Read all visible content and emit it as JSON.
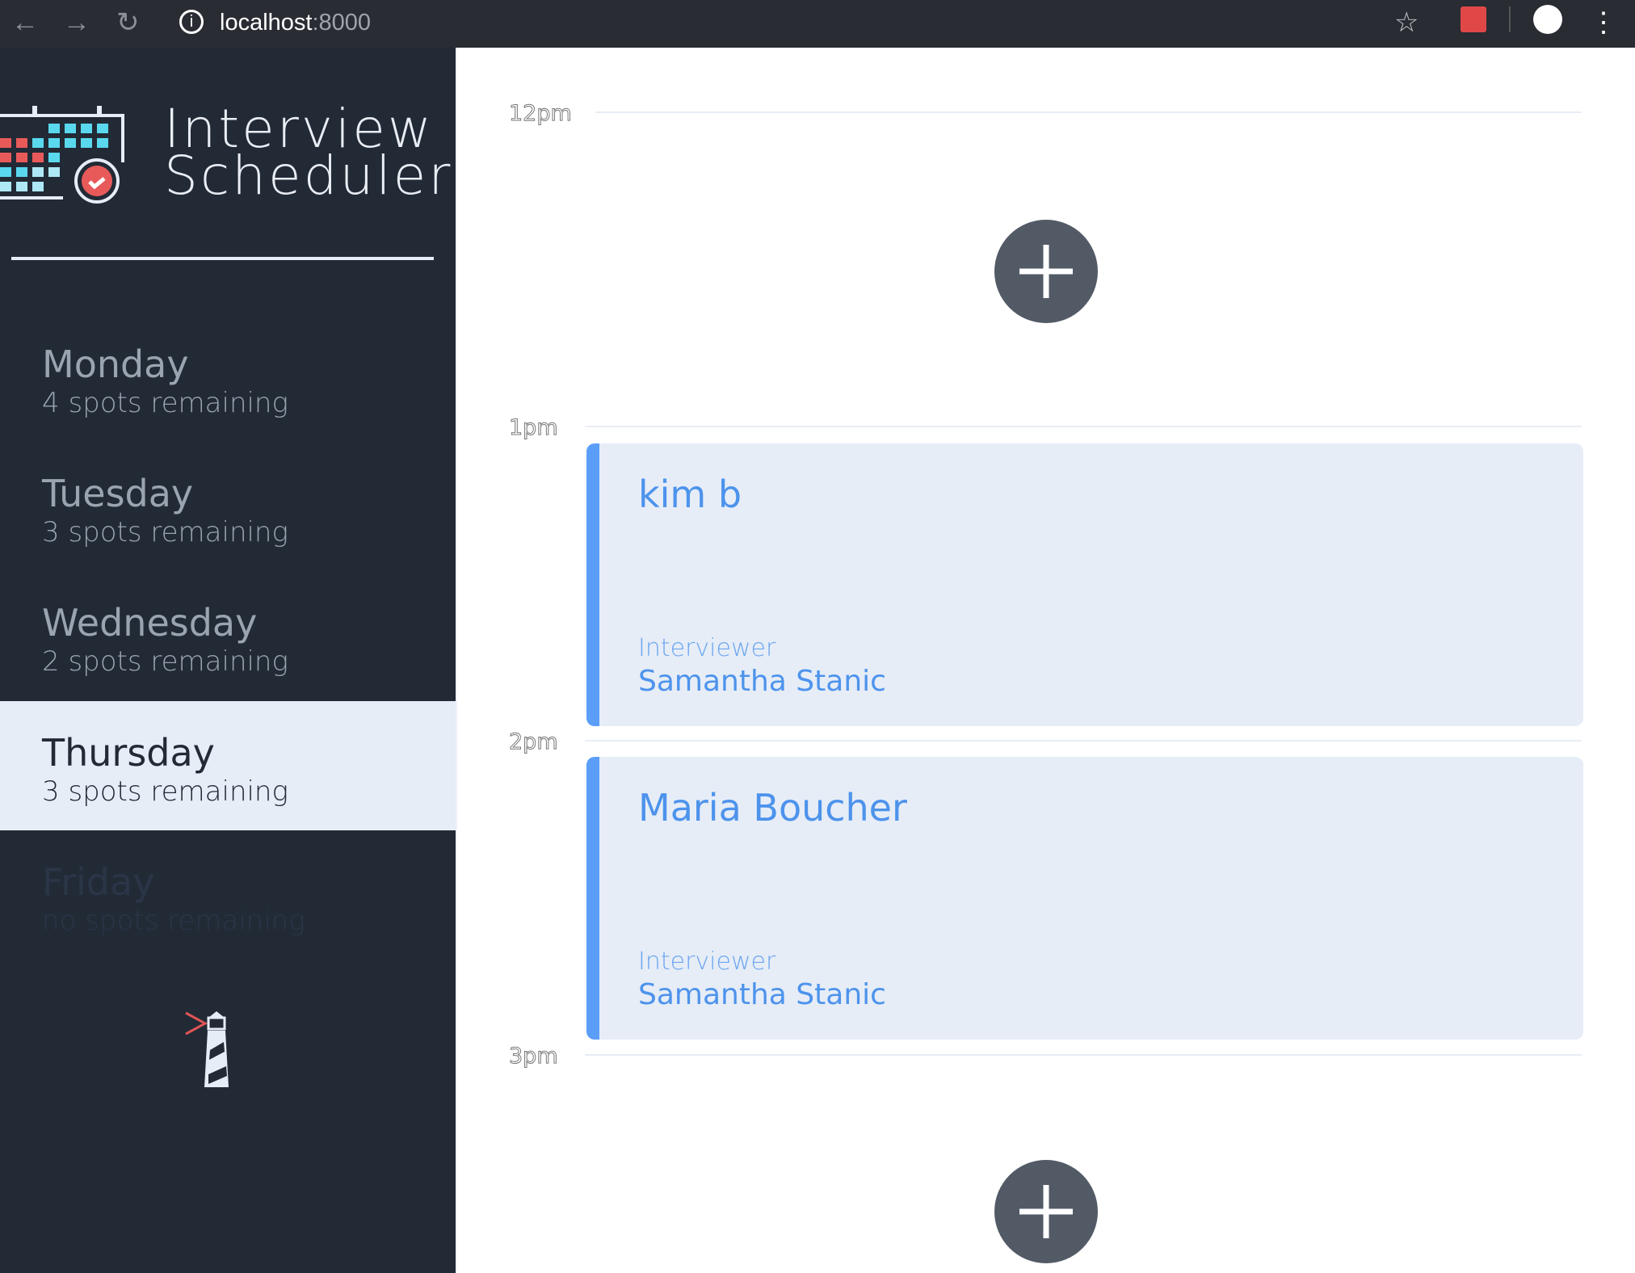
{
  "browser": {
    "url_host": "localhost",
    "url_port": ":8000"
  },
  "app": {
    "title_line1": "Interview",
    "title_line2": "Scheduler"
  },
  "days": [
    {
      "name": "Monday",
      "spots": "4 spots remaining"
    },
    {
      "name": "Tuesday",
      "spots": "3 spots remaining"
    },
    {
      "name": "Wednesday",
      "spots": "2 spots remaining"
    },
    {
      "name": "Thursday",
      "spots": "3 spots remaining",
      "selected": true
    },
    {
      "name": "Friday",
      "spots": "no spots remaining"
    }
  ],
  "schedule": {
    "times": [
      "12pm",
      "1pm",
      "2pm",
      "3pm"
    ],
    "appointments": [
      {
        "student": "kim b",
        "interviewer_label": "Interviewer",
        "interviewer": "Samantha Stanic"
      },
      {
        "student": "Maria Boucher",
        "interviewer_label": "Interviewer",
        "interviewer": "Samantha Stanic"
      }
    ]
  },
  "colors": {
    "sidebar": "#222a36",
    "selected": "#e6edf7",
    "accent": "#5b9ef8"
  }
}
